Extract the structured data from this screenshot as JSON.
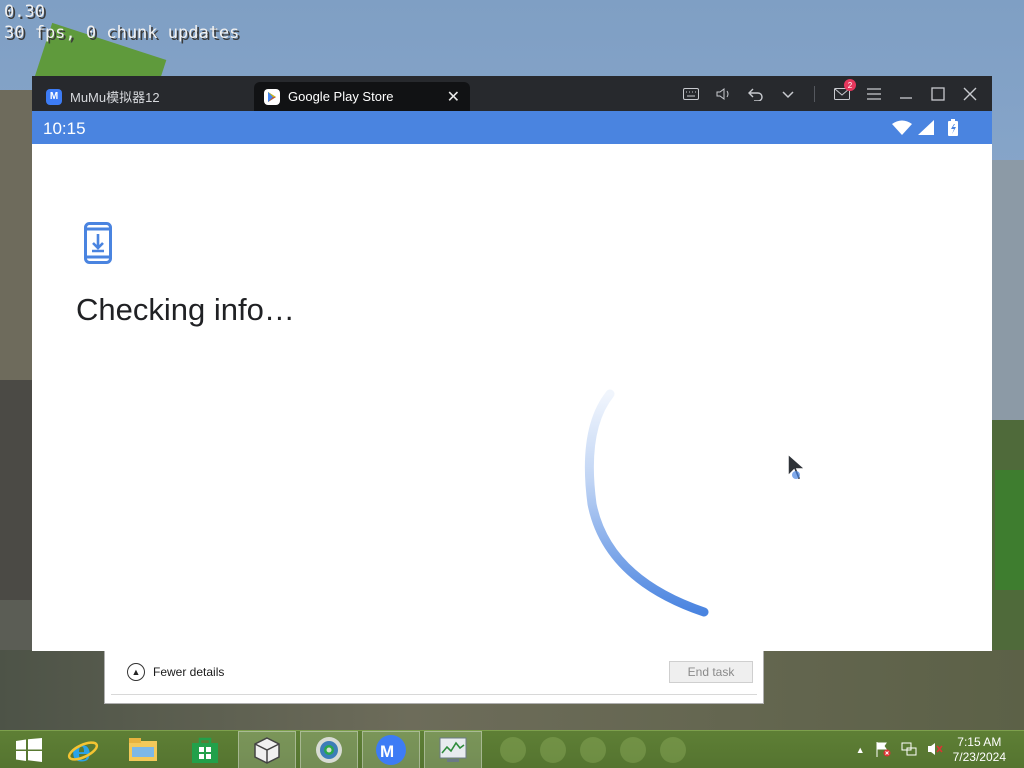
{
  "hud": {
    "line1": "0.30",
    "line2": "30 fps, 0 chunk updates"
  },
  "emulator": {
    "tabs": [
      {
        "label": "MuMu模拟器12",
        "icon": "mumu-logo-icon"
      },
      {
        "label": "Google Play Store",
        "icon": "play-store-icon",
        "close": "✕"
      }
    ],
    "controls": [
      "keyboard-icon",
      "volume-icon",
      "back-icon",
      "chevron-down-icon",
      "mail-icon",
      "menu-icon",
      "minimize-icon",
      "maximize-icon",
      "close-icon"
    ],
    "mail_badge": "2",
    "accent": "#4a84e0"
  },
  "android": {
    "status_time": "10:15",
    "heading": "Checking info…"
  },
  "task_manager": {
    "fewer_details": "Fewer details",
    "end_task": "End task"
  },
  "taskbar": {
    "apps": [
      "start-icon",
      "internet-explorer-icon",
      "file-explorer-icon",
      "store-icon",
      "app-cube-icon",
      "chrome-icon",
      "mumu-icon",
      "task-manager-icon"
    ],
    "clock_time": "7:15 AM",
    "clock_date": "7/23/2024"
  }
}
